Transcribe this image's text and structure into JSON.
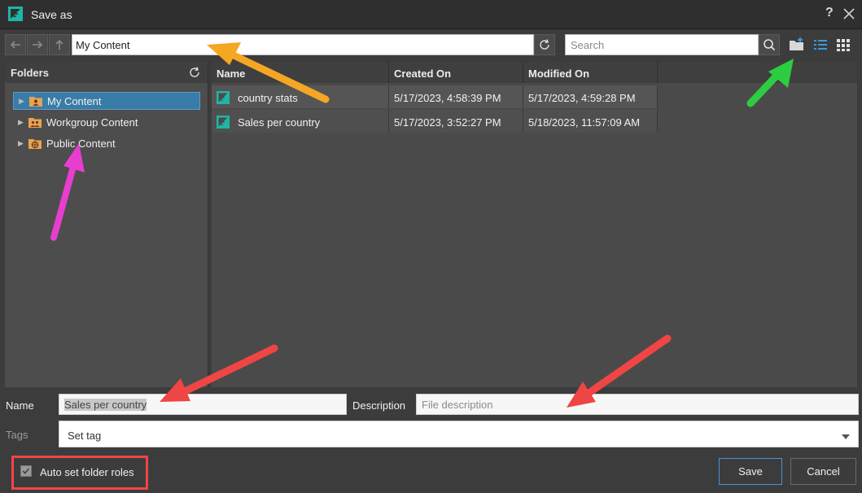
{
  "window": {
    "title": "Save as",
    "help_glyph": "?",
    "logo_icon": "logo-icon",
    "close_icon": "close-icon"
  },
  "toolbar": {
    "path_value": "My Content",
    "search_placeholder": "Search"
  },
  "folders": {
    "header": "Folders",
    "items": [
      {
        "label": "My Content",
        "selected": true
      },
      {
        "label": "Workgroup Content",
        "selected": false
      },
      {
        "label": "Public Content",
        "selected": false
      }
    ]
  },
  "files": {
    "columns": [
      "Name",
      "Created On",
      "Modified On"
    ],
    "rows": [
      {
        "name": "country stats",
        "created": "5/17/2023, 4:58:39 PM",
        "modified": "5/17/2023, 4:59:28 PM"
      },
      {
        "name": "Sales per country",
        "created": "5/17/2023, 3:52:27 PM",
        "modified": "5/18/2023, 11:57:09 AM"
      }
    ]
  },
  "form": {
    "name_label": "Name",
    "name_value": "Sales per country",
    "description_label": "Description",
    "description_placeholder": "File description",
    "tags_label": "Tags",
    "tags_value": "Set tag",
    "auto_roles_label": "Auto set folder roles",
    "auto_roles_checked": true,
    "save_label": "Save",
    "cancel_label": "Cancel"
  },
  "colors": {
    "accent_teal": "#1fb5a6",
    "selection_blue": "#3a7ca8",
    "arrow_orange": "#f5a623",
    "arrow_green": "#2ecc40",
    "arrow_magenta": "#e83ecf",
    "arrow_red": "#f04545"
  }
}
